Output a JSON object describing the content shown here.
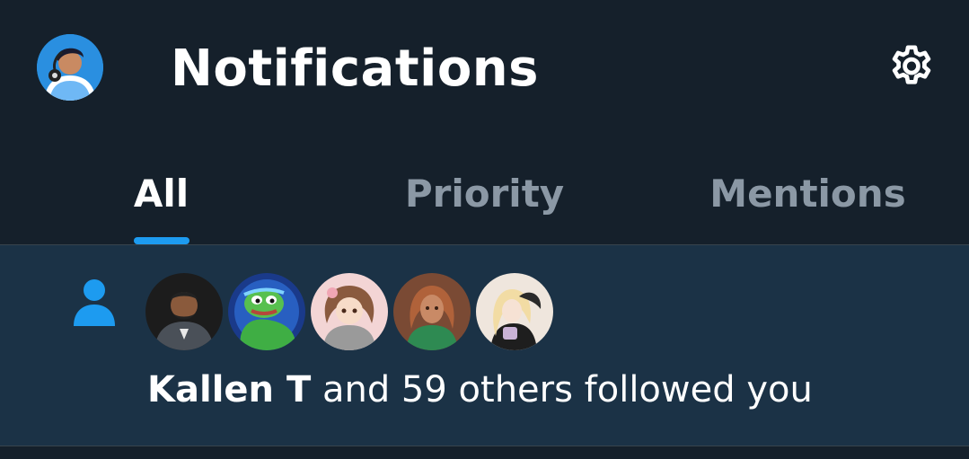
{
  "header": {
    "title": "Notifications",
    "profile_icon": "user-avatar",
    "settings_icon": "gear-icon"
  },
  "tabs": [
    {
      "label": "All",
      "active": true
    },
    {
      "label": "Priority",
      "active": false
    },
    {
      "label": "Mentions",
      "active": false
    }
  ],
  "notification": {
    "type_icon": "person-icon",
    "name": "Kallen T",
    "rest": " and 59 others followed you",
    "avatars": [
      "avatar-1",
      "avatar-2",
      "avatar-3",
      "avatar-4",
      "avatar-5"
    ]
  },
  "colors": {
    "background": "#15202b",
    "highlight_row": "#1b3246",
    "accent": "#1d9bf0",
    "muted_text": "#8b98a5",
    "divider": "#38444d"
  }
}
